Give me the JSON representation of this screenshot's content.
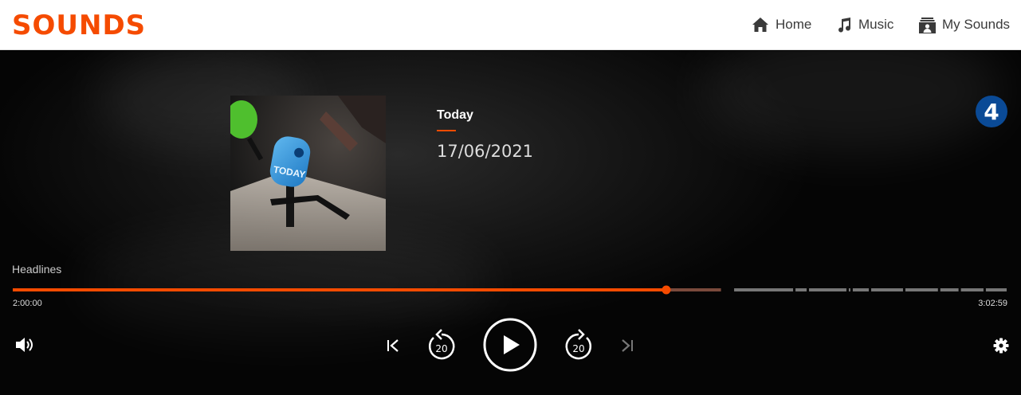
{
  "header": {
    "logo": "SOUNDS",
    "nav": [
      {
        "label": "Home",
        "icon": "home-icon"
      },
      {
        "label": "Music",
        "icon": "music-note-icon"
      },
      {
        "label": "My Sounds",
        "icon": "my-sounds-icon"
      }
    ]
  },
  "episode": {
    "title": "Today",
    "date": "17/06/2021",
    "station_badge": "4",
    "artwork_text": "TODAY",
    "segment_label": "Headlines"
  },
  "playback": {
    "elapsed": "2:00:00",
    "duration": "3:02:59",
    "progress_fraction": 0.657,
    "buffered_fraction": 0.712,
    "skip_back_seconds": "20",
    "skip_forward_seconds": "20"
  },
  "controls": {
    "volume_icon": "volume-icon",
    "previous_icon": "previous-track-icon",
    "play_icon": "play-icon",
    "next_icon": "next-track-icon",
    "settings_icon": "gear-icon"
  },
  "colors": {
    "accent": "#f54b00",
    "progress_track": "#777777",
    "background": "#000000"
  }
}
